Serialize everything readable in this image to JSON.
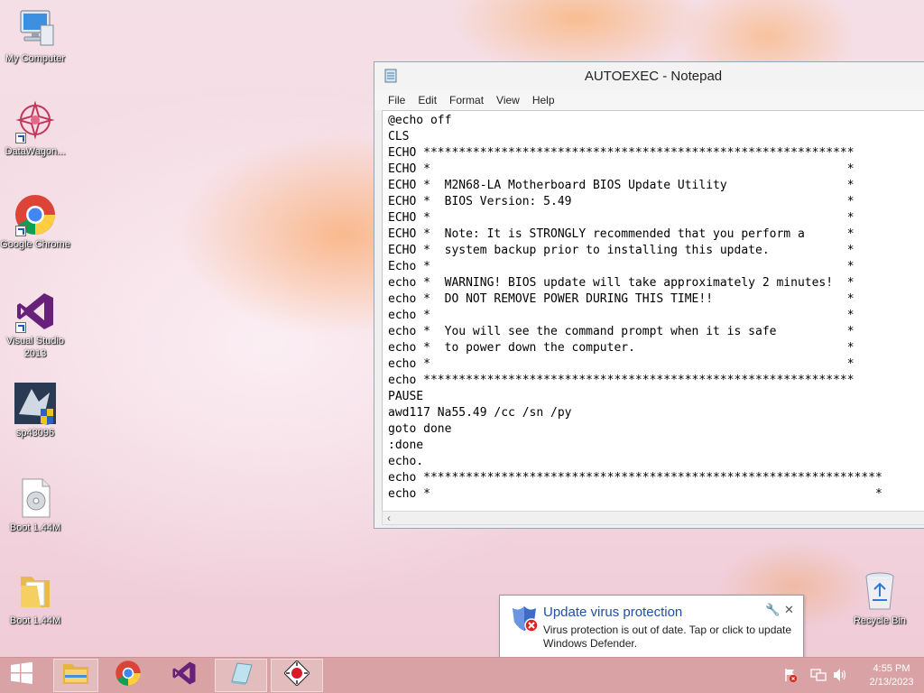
{
  "desktop": {
    "icons": [
      {
        "label": "My Computer"
      },
      {
        "label": "DataWagon..."
      },
      {
        "label": "Google Chrome"
      },
      {
        "label": "Visual Studio 2013"
      },
      {
        "label": "sp43096"
      },
      {
        "label": "Boot 1.44M"
      },
      {
        "label": "Boot 1.44M"
      },
      {
        "label": "Recycle Bin"
      }
    ]
  },
  "notepad": {
    "title": "AUTOEXEC - Notepad",
    "menu": [
      "File",
      "Edit",
      "Format",
      "View",
      "Help"
    ],
    "lines": [
      "@echo off",
      "CLS",
      "ECHO *************************************************************",
      "ECHO *                                                           *",
      "ECHO *  M2N68-LA Motherboard BIOS Update Utility                 *",
      "ECHO *  BIOS Version: 5.49                                       *",
      "ECHO *                                                           *",
      "ECHO *  Note: It is STRONGLY recommended that you perform a      *",
      "ECHO *  system backup prior to installing this update.           *",
      "Echo *                                                           *",
      "echo *  WARNING! BIOS update will take approximately 2 minutes!  *",
      "echo *  DO NOT REMOVE POWER DURING THIS TIME!!                   *",
      "echo *                                                           *",
      "echo *  You will see the command prompt when it is safe          *",
      "echo *  to power down the computer.                              *",
      "echo *                                                           *",
      "echo *************************************************************",
      "PAUSE",
      "awd117 Na55.49 /cc /sn /py",
      "goto done",
      ":done",
      "echo.",
      "echo *****************************************************************",
      "echo *                                                               *"
    ]
  },
  "toast": {
    "title": "Update virus protection",
    "body": "Virus protection is out of date. Tap or click to update Windows Defender."
  },
  "taskbar": {
    "time": "4:55 PM",
    "date": "2/13/2023"
  },
  "colors": {
    "taskbar": "#d9a2a5",
    "toast_title": "#1e4fa8"
  }
}
